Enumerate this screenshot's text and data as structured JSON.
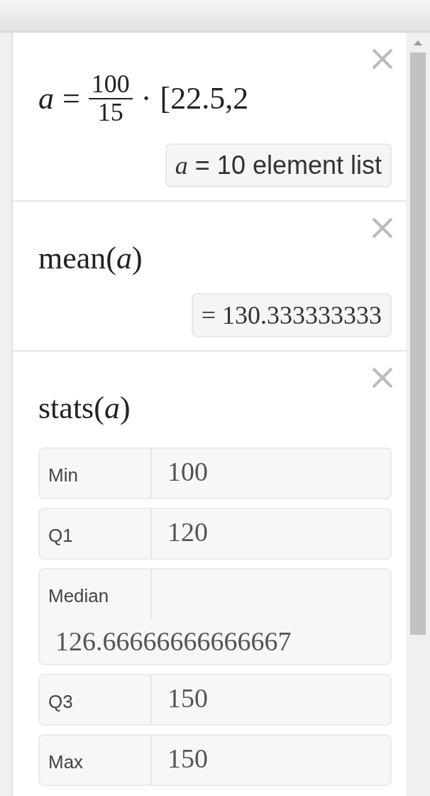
{
  "expressions": [
    {
      "kind": "assignment",
      "variable": "a",
      "equals": "=",
      "numerator": "100",
      "denominator": "15",
      "operator": "·",
      "list": "[22.5,2",
      "result": "*a* = 10 element list"
    },
    {
      "kind": "function",
      "formula": "mean(*a*)",
      "result": "= 130.333333333"
    },
    {
      "kind": "stats",
      "formula": "stats(*a*)",
      "rows": [
        {
          "label": "Min",
          "value": "100"
        },
        {
          "label": "Q1",
          "value": "120"
        },
        {
          "label": "Median",
          "value": "126.66666666666667"
        },
        {
          "label": "Q3",
          "value": "150"
        },
        {
          "label": "Max",
          "value": "150"
        }
      ]
    }
  ]
}
